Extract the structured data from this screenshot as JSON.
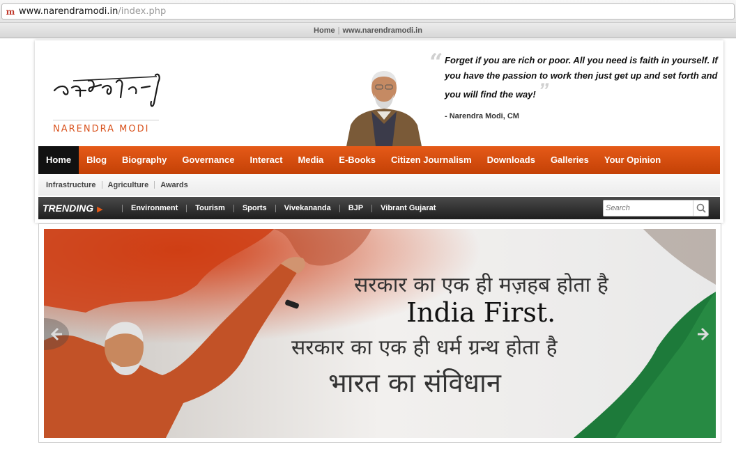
{
  "browser": {
    "favicon": "m",
    "url_domain": "www.narendramodi.in",
    "url_path": "/index.php",
    "page_title_home": "Home",
    "page_title_sep": "|",
    "page_title_site": "www.narendramodi.in"
  },
  "header": {
    "logo_name": "NARENDRA MODI",
    "quote_text": "Forget if you are rich or poor. All you need is faith in yourself. If you have the passion to work then just get up and set forth and you will find the way!",
    "quote_author": "- Narendra Modi, CM"
  },
  "nav": {
    "items": [
      {
        "label": "Home"
      },
      {
        "label": "Blog"
      },
      {
        "label": "Biography"
      },
      {
        "label": "Governance"
      },
      {
        "label": "Interact"
      },
      {
        "label": "Media"
      },
      {
        "label": "E-Books"
      },
      {
        "label": "Citizen Journalism"
      },
      {
        "label": "Downloads"
      },
      {
        "label": "Galleries"
      },
      {
        "label": "Your Opinion"
      }
    ]
  },
  "subnav": {
    "items": [
      {
        "label": "Infrastructure"
      },
      {
        "label": "Agriculture"
      },
      {
        "label": "Awards"
      }
    ]
  },
  "trending": {
    "label": "TRENDING",
    "items": [
      {
        "label": "Environment"
      },
      {
        "label": "Tourism"
      },
      {
        "label": "Sports"
      },
      {
        "label": "Vivekananda"
      },
      {
        "label": "BJP"
      },
      {
        "label": "Vibrant Gujarat"
      }
    ],
    "search_placeholder": "Search"
  },
  "slide": {
    "line1": "सरकार का एक ही मज़हब होता है",
    "line2": "India First.",
    "line3": "सरकार का एक ही धर्म ग्रन्थ होता है",
    "line4": "भारत का संविधान"
  },
  "colors": {
    "accent_orange": "#e55a18",
    "nav_active": "#111111",
    "trending_bg": "#2a2a2a"
  }
}
